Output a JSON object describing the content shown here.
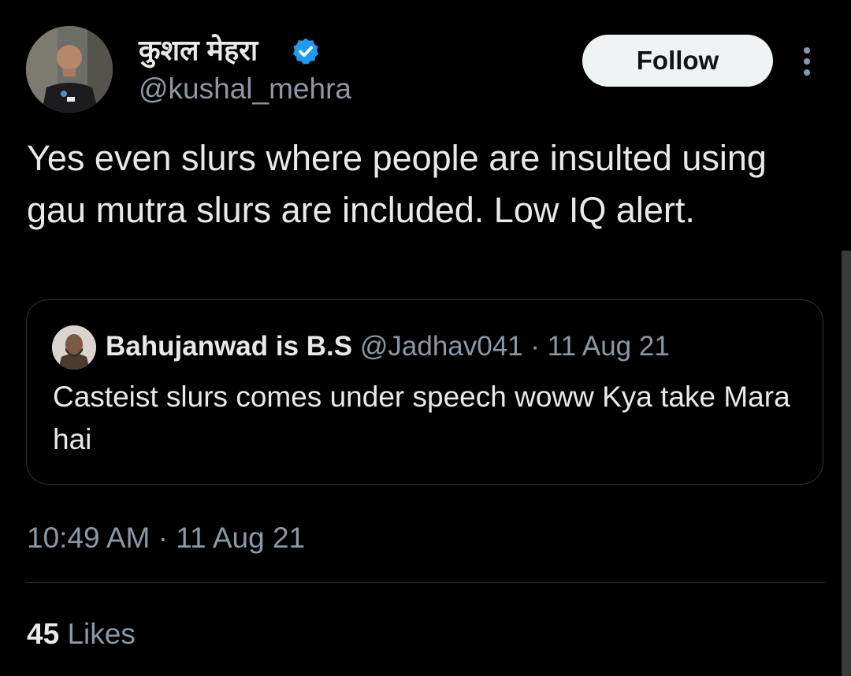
{
  "author": {
    "display_name": "कुशल मेहरा",
    "handle": "@kushal_mehra",
    "verified": true
  },
  "follow_button": {
    "label": "Follow"
  },
  "more_button": {
    "icon": "more-vertical-icon"
  },
  "tweet": {
    "text": "Yes even slurs where people are insulted using gau mutra slurs are included. Low IQ alert.",
    "timestamp": "10:49 AM · 11 Aug 21"
  },
  "quoted_tweet": {
    "display_name": "Bahujanwad is B.S",
    "meta": "@Jadhav041 · 11 Aug 21",
    "text": "Casteist slurs comes under speech woww Kya take Mara hai"
  },
  "engagement": {
    "likes_count": "45",
    "likes_label": "Likes"
  },
  "colors": {
    "background": "#000000",
    "primary_text": "#e7e9ea",
    "secondary_text": "#8b98a5",
    "verified_blue": "#1d9bf0",
    "border": "#2f3336",
    "follow_bg": "#eff3f4"
  }
}
